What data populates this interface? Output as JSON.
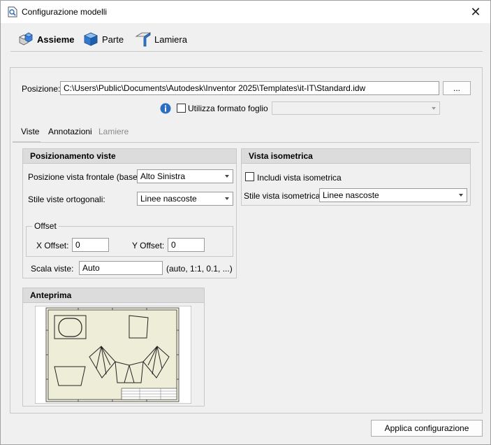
{
  "window": {
    "title": "Configurazione modelli",
    "close_glyph": "✕"
  },
  "ribbon": {
    "tabs": [
      {
        "label": "Assieme",
        "icon": "assembly-icon",
        "active": true
      },
      {
        "label": "Parte",
        "icon": "part-icon",
        "active": false
      },
      {
        "label": "Lamiera",
        "icon": "sheet-metal-icon",
        "active": false
      }
    ]
  },
  "position": {
    "label": "Posizione:",
    "value": "C:\\Users\\Public\\Documents\\Autodesk\\Inventor 2025\\Templates\\it-IT\\Standard.idw",
    "browse_label": "..."
  },
  "sheet_format": {
    "info_icon": "info-icon",
    "checkbox_label": "Utilizza formato foglio",
    "checked": false,
    "combo_value": ""
  },
  "subtabs": [
    {
      "label": "Viste",
      "enabled": true,
      "active": true
    },
    {
      "label": "Annotazioni",
      "enabled": true,
      "active": false
    },
    {
      "label": "Lamiere",
      "enabled": false,
      "active": false
    }
  ],
  "view_placement": {
    "header": "Posizionamento viste",
    "front_view_label": "Posizione vista frontale (base):",
    "front_view_value": "Alto Sinistra",
    "ortho_style_label": "Stile viste ortogonali:",
    "ortho_style_value": "Linee nascoste",
    "offset": {
      "legend": "Offset",
      "x_label": "X Offset:",
      "x_value": "0",
      "y_label": "Y Offset:",
      "y_value": "0"
    },
    "scale_label": "Scala viste:",
    "scale_value": "Auto",
    "scale_hint": "(auto, 1:1, 0.1, ...)"
  },
  "iso_view": {
    "header": "Vista isometrica",
    "include_label": "Includi vista isometrica",
    "include_checked": false,
    "style_label": "Stile vista isometrica:",
    "style_value": "Linee nascoste"
  },
  "preview": {
    "header": "Anteprima"
  },
  "footer": {
    "apply_label": "Applica configurazione"
  },
  "colors": {
    "header_bg": "#dcdcdc",
    "info_blue": "#2b6fc0",
    "sheet_bg": "#eeeed8"
  }
}
